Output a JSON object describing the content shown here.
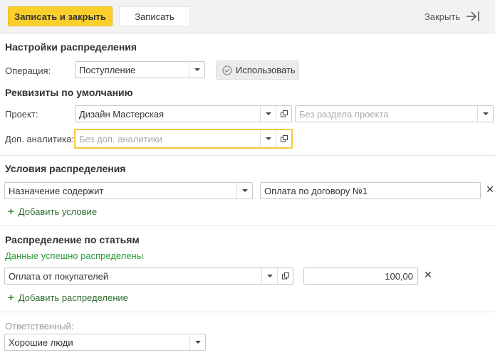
{
  "toolbar": {
    "save_close": "Записать и закрыть",
    "save": "Записать",
    "close": "Закрыть"
  },
  "settings": {
    "title": "Настройки распределения",
    "operation_label": "Операция:",
    "operation_value": "Поступление",
    "use_button": "Использовать"
  },
  "defaults": {
    "title": "Реквизиты по умолчанию",
    "project_label": "Проект:",
    "project_value": "Дизайн Мастерская",
    "project_section_placeholder": "Без раздела проекта",
    "analytics_label": "Доп. аналитика:",
    "analytics_placeholder": "Без доп. аналитики"
  },
  "conditions": {
    "title": "Условия распределения",
    "condition_field": "Назначение содержит",
    "condition_value": "Оплата по договору №1",
    "add_condition": "Добавить условие"
  },
  "distribution": {
    "title": "Распределение по статьям",
    "status": "Данные успешно распределены",
    "item_value": "Оплата от покупателей",
    "amount": "100,00",
    "add_distribution": "Добавить распределение"
  },
  "responsible": {
    "label": "Ответственный:",
    "value": "Хорошие люди"
  },
  "colors": {
    "accent": "#fbcf2b",
    "success": "#2e9a3f",
    "focus_border": "#f4c73d"
  }
}
